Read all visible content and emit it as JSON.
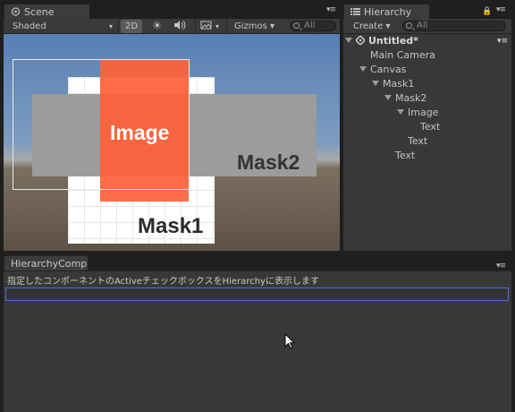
{
  "scene": {
    "tab_label": "Scene",
    "shading": "Shaded",
    "mode_2d": "2D",
    "gizmos": "Gizmos",
    "search": "All",
    "labels": {
      "image": "Image",
      "mask2": "Mask2",
      "mask1": "Mask1"
    },
    "colors": {
      "orange": "#ff6138",
      "gray": "#9c9c9c",
      "white": "#ffffff"
    }
  },
  "hierarchy": {
    "tab_label": "Hierarchy",
    "create": "Create",
    "search": "All",
    "root": "Untitled*",
    "items": [
      {
        "label": "Main Camera"
      },
      {
        "label": "Canvas"
      },
      {
        "label": "Mask1"
      },
      {
        "label": "Mask2"
      },
      {
        "label": "Image"
      },
      {
        "label": "Text"
      },
      {
        "label": "Text"
      },
      {
        "label": "Text"
      }
    ]
  },
  "bottom": {
    "tab_label": "HierarchyComp",
    "description": "指定したコンポーネントのActiveチェックボックスをHierarchyに表示します"
  }
}
